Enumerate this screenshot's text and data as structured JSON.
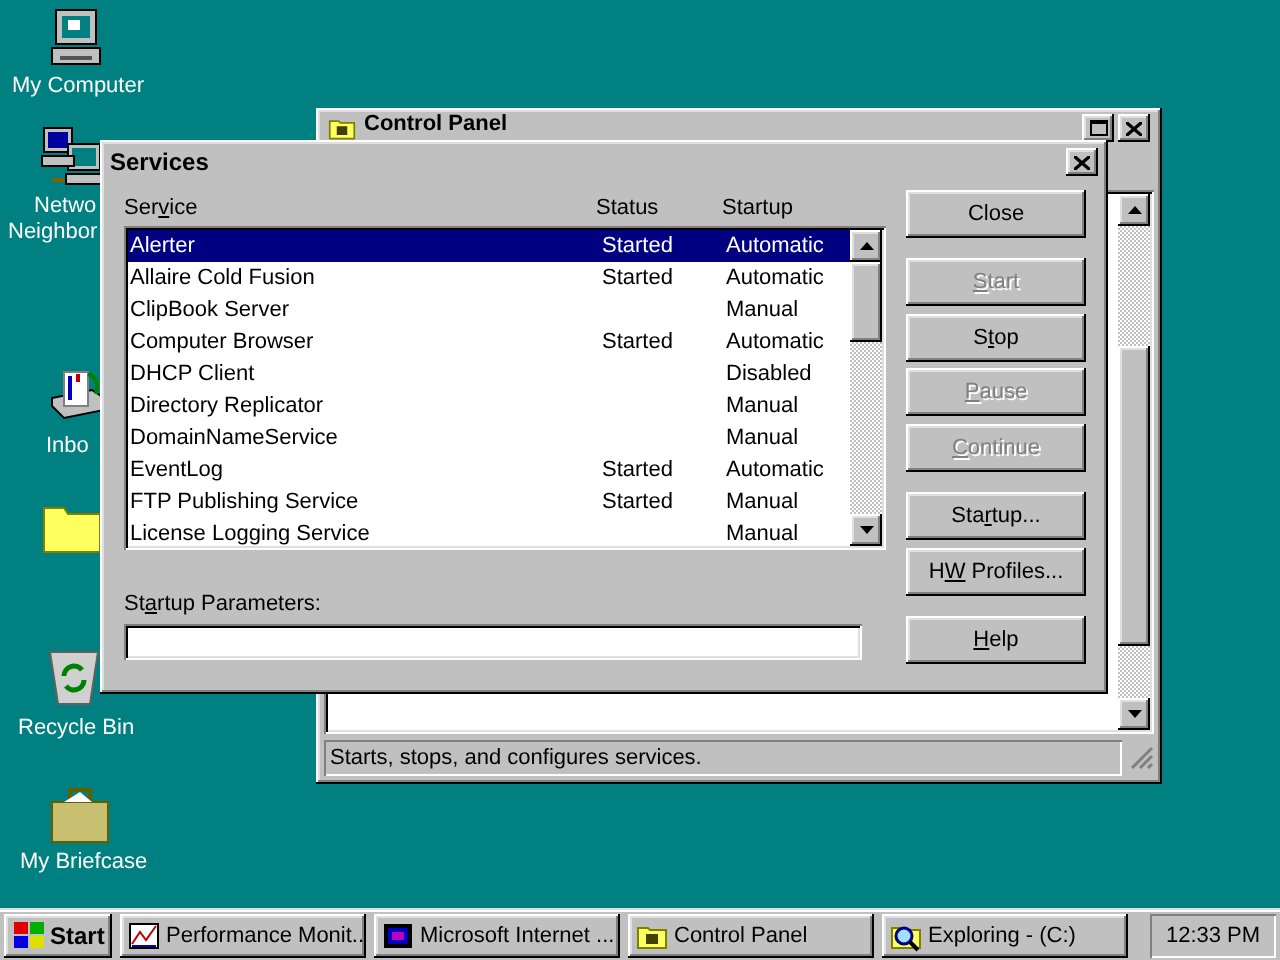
{
  "desktop": {
    "icons": [
      {
        "kind": "computer",
        "label_lines": [
          "My Computer"
        ]
      },
      {
        "kind": "network",
        "label_lines": [
          "Netwo",
          "Neighbor"
        ]
      },
      {
        "kind": "inbox",
        "label_lines": [
          "Inbo"
        ]
      },
      {
        "kind": "folder"
      },
      {
        "kind": "recycle",
        "label_lines": [
          "Recycle Bin"
        ]
      },
      {
        "kind": "briefcase",
        "label_lines": [
          "My Briefcase"
        ]
      }
    ]
  },
  "control_panel": {
    "title": "Control Panel",
    "status_bar": "Starts, stops, and configures services."
  },
  "dialog": {
    "title": "Services",
    "columns": [
      {
        "label": {
          "before": "Ser",
          "accel": "v",
          "after": "ice"
        }
      },
      {
        "label": {
          "before": "Status"
        }
      },
      {
        "label": {
          "before": "Startup"
        }
      }
    ],
    "rows": [
      {
        "service": "Alerter",
        "status": "Started",
        "startup": "Automatic",
        "selected": true
      },
      {
        "service": "Allaire Cold Fusion",
        "status": "Started",
        "startup": "Automatic",
        "selected": false
      },
      {
        "service": "ClipBook Server",
        "status": "",
        "startup": "Manual",
        "selected": false
      },
      {
        "service": "Computer Browser",
        "status": "Started",
        "startup": "Automatic",
        "selected": false
      },
      {
        "service": "DHCP Client",
        "status": "",
        "startup": "Disabled",
        "selected": false
      },
      {
        "service": "Directory Replicator",
        "status": "",
        "startup": "Manual",
        "selected": false
      },
      {
        "service": "DomainNameService",
        "status": "",
        "startup": "Manual",
        "selected": false
      },
      {
        "service": "EventLog",
        "status": "Started",
        "startup": "Automatic",
        "selected": false
      },
      {
        "service": "FTP Publishing Service",
        "status": "Started",
        "startup": "Manual",
        "selected": false
      },
      {
        "service": "License Logging Service",
        "status": "",
        "startup": "Manual",
        "selected": false
      }
    ],
    "parameters": {
      "label": {
        "before": "St",
        "accel": "a",
        "after": "rtup Parameters:"
      }
    },
    "buttons": [
      {
        "label": {
          "before": "Close"
        },
        "disabled": false
      },
      {
        "label": {
          "accel": "S",
          "after": "tart"
        },
        "disabled": true
      },
      {
        "label": {
          "before": "S",
          "accel": "t",
          "after": "op"
        },
        "disabled": false
      },
      {
        "label": {
          "accel": "P",
          "after": "ause"
        },
        "disabled": true
      },
      {
        "label": {
          "accel": "C",
          "after": "ontinue"
        },
        "disabled": true
      },
      {
        "label": {
          "before": "Sta",
          "accel": "r",
          "after": "tup..."
        },
        "disabled": false
      },
      {
        "label": {
          "before": "H",
          "accel": "W",
          "after": " Profiles..."
        },
        "disabled": false
      },
      {
        "label": {
          "accel": "H",
          "after": "elp"
        },
        "disabled": false
      }
    ]
  },
  "taskbar": {
    "start": "Start",
    "tasks": [
      {
        "kind": "monitor",
        "label": "Performance Monit..."
      },
      {
        "kind": "browser",
        "label": "Microsoft Internet ..."
      },
      {
        "kind": "control",
        "label": "Control Panel"
      },
      {
        "kind": "explore",
        "label": "Exploring -  (C:)"
      }
    ],
    "clock": "12:33 PM"
  }
}
